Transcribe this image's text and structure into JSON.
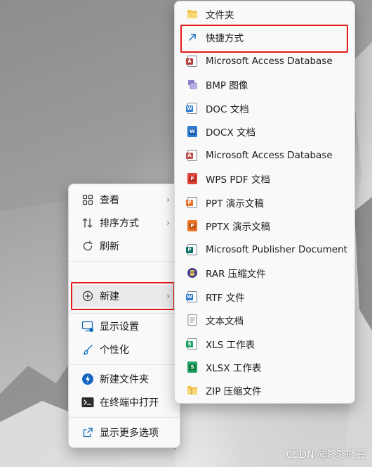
{
  "context_menu": {
    "items": [
      {
        "label": "查看",
        "icon": "grid-view-icon",
        "has_submenu": true
      },
      {
        "label": "排序方式",
        "icon": "sort-icon",
        "has_submenu": true
      },
      {
        "label": "刷新",
        "icon": "refresh-icon",
        "has_submenu": false
      },
      {
        "label": "新建",
        "icon": "new-plus-icon",
        "has_submenu": true,
        "highlighted": true
      },
      {
        "label": "显示设置",
        "icon": "display-settings-icon",
        "has_submenu": false
      },
      {
        "label": "个性化",
        "icon": "brush-icon",
        "has_submenu": false
      },
      {
        "label": "新建文件夹",
        "icon": "new-folder-icon",
        "has_submenu": false
      },
      {
        "label": "在终端中打开",
        "icon": "terminal-icon",
        "has_submenu": false
      },
      {
        "label": "显示更多选项",
        "icon": "more-options-icon",
        "has_submenu": false
      }
    ],
    "submenu_arrow": "›"
  },
  "new_submenu": {
    "items": [
      {
        "label": "文件夹",
        "icon": "folder-icon"
      },
      {
        "label": "快捷方式",
        "icon": "shortcut-icon",
        "highlighted": true
      },
      {
        "label": "Microsoft Access Database",
        "icon": "access-icon",
        "tag": "A"
      },
      {
        "label": "BMP 图像",
        "icon": "bmp-image-icon"
      },
      {
        "label": "DOC 文档",
        "icon": "doc-icon",
        "tag": "W"
      },
      {
        "label": "DOCX 文档",
        "icon": "docx-icon",
        "tag": "W"
      },
      {
        "label": "Microsoft Access Database",
        "icon": "access-icon",
        "tag": "A"
      },
      {
        "label": "WPS PDF 文档",
        "icon": "pdf-icon",
        "tag": "P"
      },
      {
        "label": "PPT 演示文稿",
        "icon": "ppt-icon",
        "tag": "P"
      },
      {
        "label": "PPTX 演示文稿",
        "icon": "pptx-icon",
        "tag": "P"
      },
      {
        "label": "Microsoft Publisher Document",
        "icon": "publisher-icon",
        "tag": "P"
      },
      {
        "label": "RAR 压缩文件",
        "icon": "rar-icon"
      },
      {
        "label": "RTF 文件",
        "icon": "rtf-icon",
        "tag": "W"
      },
      {
        "label": "文本文档",
        "icon": "text-document-icon"
      },
      {
        "label": "XLS 工作表",
        "icon": "xls-icon",
        "tag": "S"
      },
      {
        "label": "XLSX 工作表",
        "icon": "xlsx-icon",
        "tag": "S"
      },
      {
        "label": "ZIP 压缩文件",
        "icon": "zip-folder-icon"
      }
    ]
  },
  "watermark": "CSDN @咚咚咚豆",
  "colors": {
    "highlight_border": "#e21b1b",
    "accent_blue": "#0f6cbd",
    "word_blue": "#2b7cd3",
    "pdf_red": "#e0433a",
    "ppt_orange": "#e8752a",
    "excel_green": "#21a366",
    "publisher_teal": "#077568",
    "access_red": "#b73b3b"
  }
}
